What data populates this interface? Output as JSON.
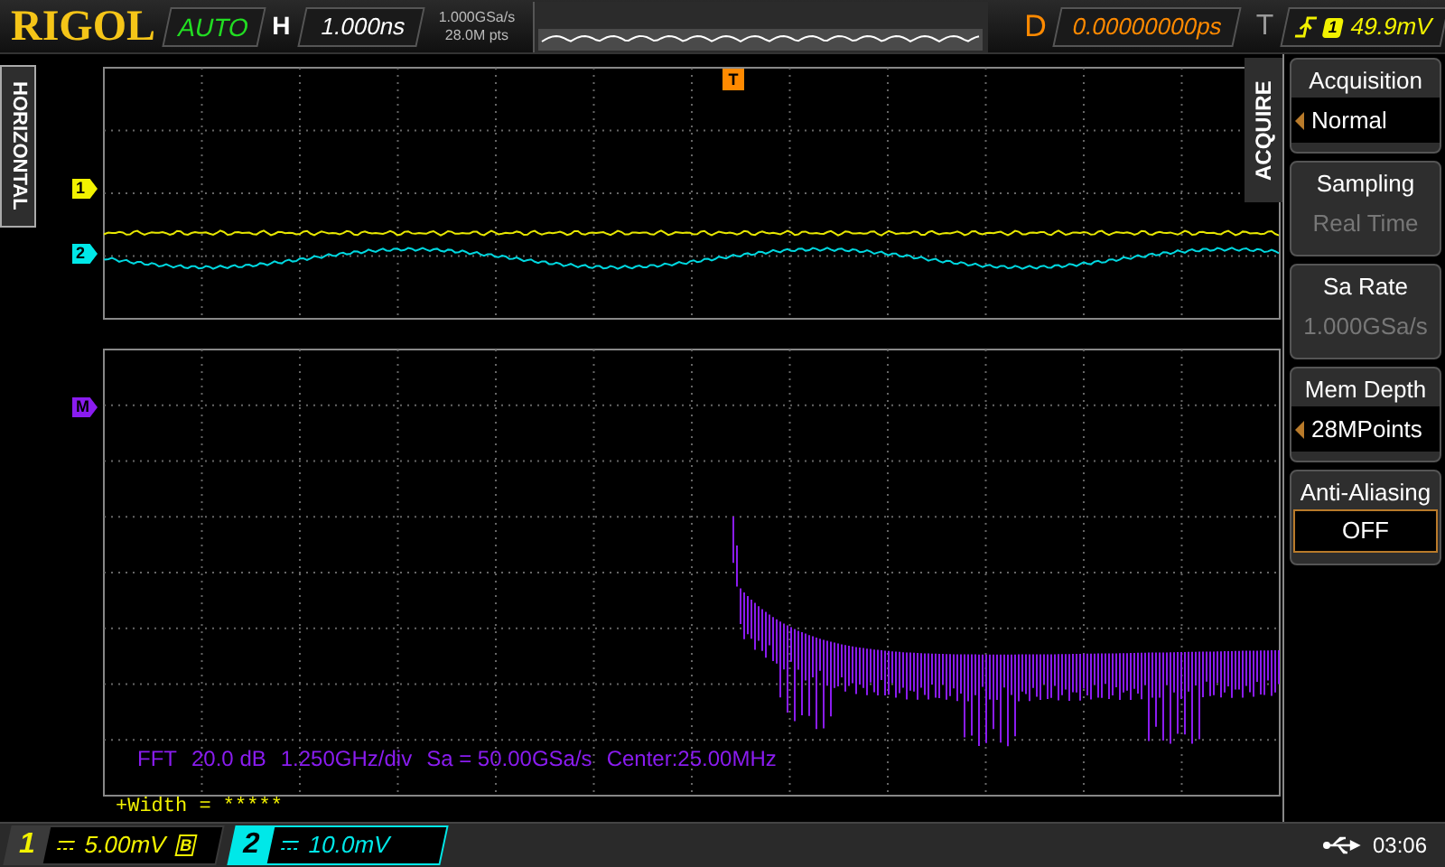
{
  "top_bar": {
    "logo": "RIGOL",
    "run_state": "AUTO",
    "horizontal_label": "H",
    "timebase": "1.000ns",
    "sample_rate": "1.000GSa/s",
    "memory": "28.0M pts",
    "delay_label": "D",
    "delay": "0.00000000ps",
    "trigger_label": "T",
    "trigger_source": "1",
    "trigger_level": "49.9mV"
  },
  "side_tab": "HORIZONTAL",
  "display": {
    "trigger_marker": "T",
    "markers": [
      {
        "label": "1",
        "color": "#f2f200"
      },
      {
        "label": "2",
        "color": "#00e8e8"
      },
      {
        "label": "M",
        "color": "#8a1cf0"
      }
    ],
    "fft_info": [
      "FFT",
      "20.0 dB",
      "1.250GHz/div",
      "Sa = 50.00GSa/s",
      "Center:25.00MHz"
    ],
    "measurement": "+Width = *****"
  },
  "menu": {
    "title": "ACQUIRE",
    "items": [
      {
        "label": "Acquisition",
        "value": "Normal",
        "kind": "select"
      },
      {
        "label": "Sampling",
        "value": "Real Time",
        "kind": "readonly"
      },
      {
        "label": "Sa Rate",
        "value": "1.000GSa/s",
        "kind": "readonly"
      },
      {
        "label": "Mem Depth",
        "value": "28MPoints",
        "kind": "select"
      },
      {
        "label": "Anti-Aliasing",
        "value": "OFF",
        "kind": "toggle"
      }
    ]
  },
  "status_bar": {
    "channels": [
      {
        "number": "1",
        "scale": "5.00mV",
        "badge": "B",
        "selected": false,
        "color": "#f2f200"
      },
      {
        "number": "2",
        "scale": "10.0mV",
        "selected": true,
        "color": "#00e8e8"
      }
    ],
    "time": "03:06"
  }
}
